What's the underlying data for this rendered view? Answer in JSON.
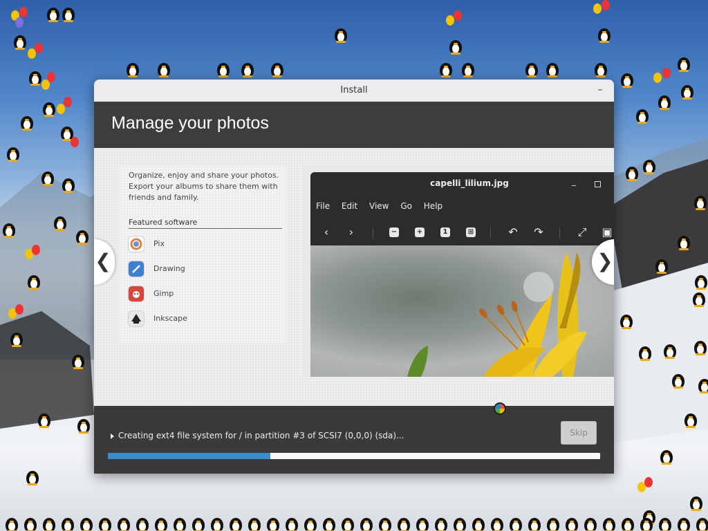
{
  "installer": {
    "window_title": "Install",
    "header_title": "Manage your photos",
    "description": "Organize, enjoy and share your photos. Export your albums to share them with friends and family.",
    "featured_heading": "Featured software",
    "apps": [
      {
        "label": "Pix",
        "icon": "pix-icon"
      },
      {
        "label": "Drawing",
        "icon": "drawing-icon"
      },
      {
        "label": "Gimp",
        "icon": "gimp-icon"
      },
      {
        "label": "Inkscape",
        "icon": "inkscape-icon"
      }
    ],
    "prev_glyph": "❮",
    "next_glyph": "❯"
  },
  "viewer": {
    "title": "capelli_lilium.jpg",
    "menu": [
      "File",
      "Edit",
      "View",
      "Go",
      "Help"
    ]
  },
  "progress": {
    "status_text": "Creating ext4 file system for / in partition #3 of SCSI7 (0,0,0) (sda)...",
    "skip_label": "Skip",
    "fraction": 0.33
  },
  "colors": {
    "header_bg": "#3d3d3d",
    "progress_fill": "#3a8dcc"
  }
}
